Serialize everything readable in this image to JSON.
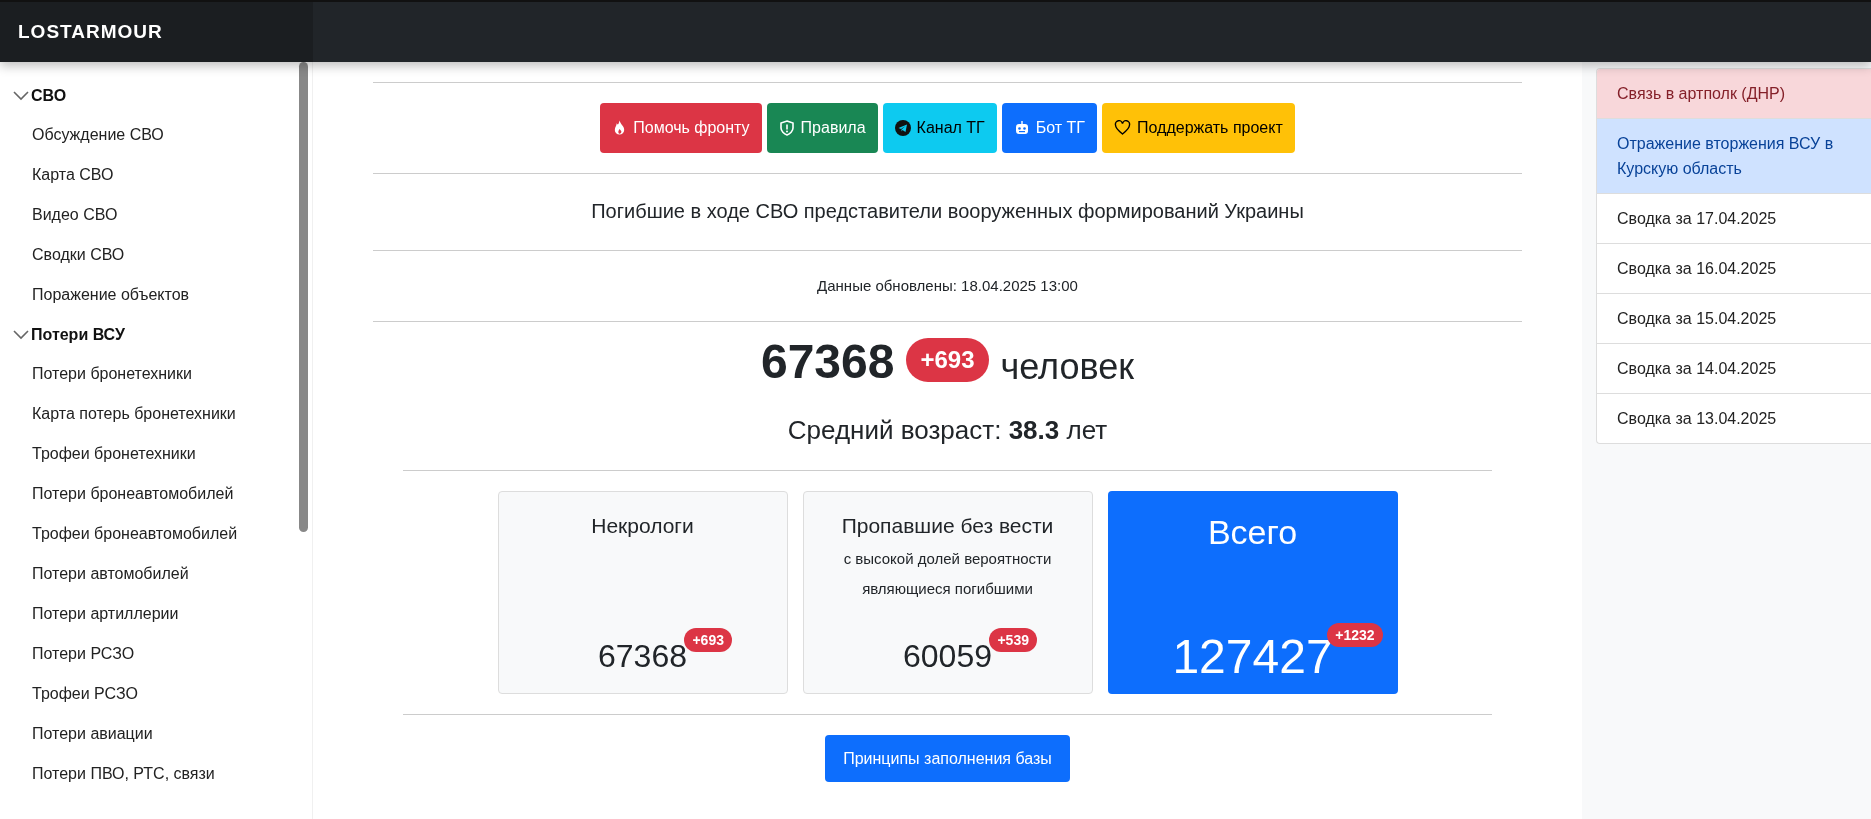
{
  "header": {
    "logo": "LOSTARMOUR"
  },
  "sidebar": {
    "groups": [
      {
        "title": "СВО",
        "expanded": true,
        "children": [
          {
            "label": "Обсуждение СВО"
          },
          {
            "label": "Карта СВО"
          },
          {
            "label": "Видео СВО"
          },
          {
            "label": "Сводки СВО"
          },
          {
            "label": "Поражение объектов"
          }
        ]
      },
      {
        "title": "Потери ВСУ",
        "expanded": true,
        "children": [
          {
            "label": "Потери бронетехники"
          },
          {
            "label": "Карта потерь бронетехники"
          },
          {
            "label": "Трофеи бронетехники"
          },
          {
            "label": "Потери бронеавтомобилей"
          },
          {
            "label": "Трофеи бронеавтомобилей"
          },
          {
            "label": "Потери автомобилей"
          },
          {
            "label": "Потери артиллерии"
          },
          {
            "label": "Потери РСЗО"
          },
          {
            "label": "Трофеи РСЗО"
          },
          {
            "label": "Потери авиации"
          },
          {
            "label": "Потери ПВО, РТС, связи"
          }
        ]
      }
    ]
  },
  "action_buttons": [
    {
      "label": "Помочь фронту",
      "kind": "fire",
      "color": "#dc3545"
    },
    {
      "label": "Правила",
      "kind": "shield",
      "color": "#198754"
    },
    {
      "label": "Канал ТГ",
      "kind": "telegram",
      "color": "#0dcaf0"
    },
    {
      "label": "Бот ТГ",
      "kind": "robot",
      "color": "#0d6efd"
    },
    {
      "label": "Поддержать проект",
      "kind": "heart",
      "color": "#ffc107"
    }
  ],
  "title": "Погибшие в ходе СВО представители вооруженных формирований Украины",
  "updated": "Данные обновлены: 18.04.2025 13:00",
  "total": {
    "count": "67368",
    "delta": "+693",
    "unit": "человек"
  },
  "average_age": "Средний возраст: **38.3** лет",
  "cards": [
    {
      "kind": "plain",
      "title": "Некрологи",
      "value": "67368",
      "delta": "+693"
    },
    {
      "kind": "plain",
      "title": "Пропавшие без вести",
      "subtitle": "с высокой долей вероятности являющиеся погибшими",
      "value": "60059",
      "delta": "+539"
    },
    {
      "kind": "total",
      "title": "Всего",
      "value": "127427",
      "delta": "+1232"
    }
  ],
  "principles_button": "Принципы заполнения базы",
  "news": [
    {
      "label": "Связь в артполк (ДНР)",
      "kind": "danger"
    },
    {
      "label": "Отражение вторжения ВСУ в Курскую область",
      "kind": "primary"
    },
    {
      "label": "Сводка за 17.04.2025",
      "kind": "plain"
    },
    {
      "label": "Сводка за 16.04.2025",
      "kind": "plain"
    },
    {
      "label": "Сводка за 15.04.2025",
      "kind": "plain"
    },
    {
      "label": "Сводка за 14.04.2025",
      "kind": "plain"
    },
    {
      "label": "Сводка за 13.04.2025",
      "kind": "plain"
    }
  ]
}
